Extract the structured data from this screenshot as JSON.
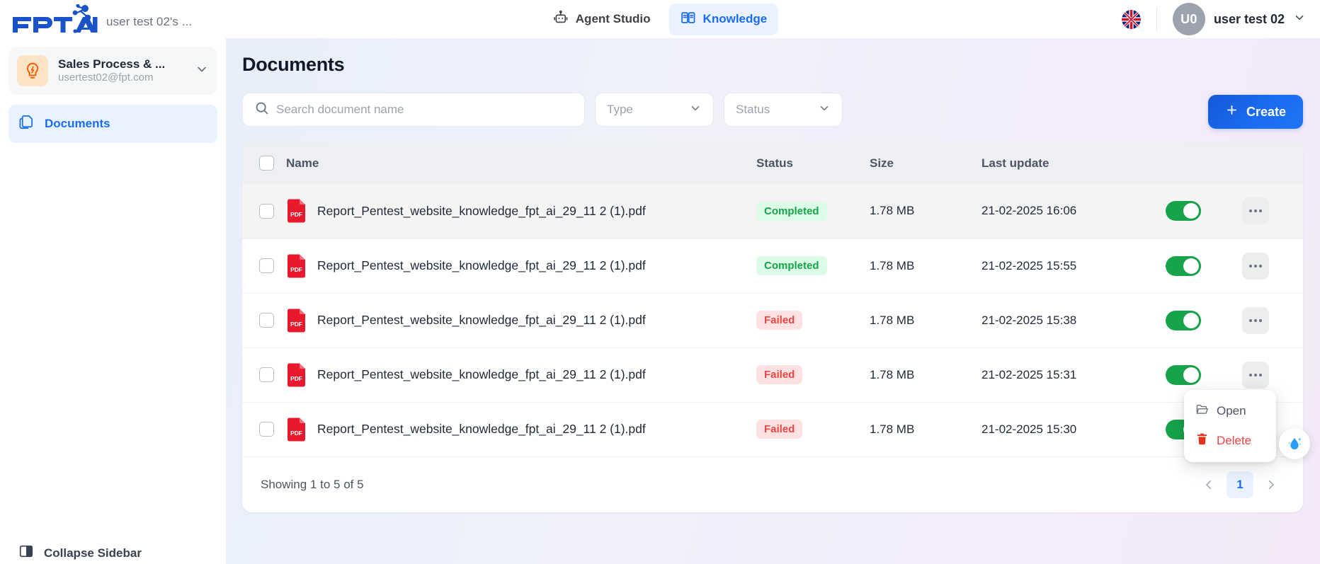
{
  "header": {
    "brand_sub": "user test 02's ...",
    "nav": [
      {
        "label": "Agent Studio",
        "icon": "robot-icon",
        "active": false
      },
      {
        "label": "Knowledge",
        "icon": "book-icon",
        "active": true
      }
    ],
    "flag": "uk-flag-icon",
    "avatar_initials": "U0",
    "user_name": "user test 02"
  },
  "sidebar": {
    "kb_title": "Sales Process & ...",
    "kb_email": "usertest02@fpt.com",
    "nav_documents": "Documents",
    "collapse_label": "Collapse Sidebar"
  },
  "main": {
    "page_title": "Documents",
    "search_placeholder": "Search document name",
    "search_value": "",
    "type_label": "Type",
    "status_label": "Status",
    "create_label": "Create"
  },
  "table": {
    "columns": [
      "Name",
      "Status",
      "Size",
      "Last update"
    ],
    "rows": [
      {
        "name": "Report_Pentest_website_knowledge_fpt_ai_29_11 2 (1).pdf",
        "status": "Completed",
        "size": "1.78 MB",
        "updated": "21-02-2025 16:06",
        "enabled": true,
        "filetype": "PDF"
      },
      {
        "name": "Report_Pentest_website_knowledge_fpt_ai_29_11 2 (1).pdf",
        "status": "Completed",
        "size": "1.78 MB",
        "updated": "21-02-2025 15:55",
        "enabled": true,
        "filetype": "PDF"
      },
      {
        "name": "Report_Pentest_website_knowledge_fpt_ai_29_11 2 (1).pdf",
        "status": "Failed",
        "size": "1.78 MB",
        "updated": "21-02-2025 15:38",
        "enabled": true,
        "filetype": "PDF"
      },
      {
        "name": "Report_Pentest_website_knowledge_fpt_ai_29_11 2 (1).pdf",
        "status": "Failed",
        "size": "1.78 MB",
        "updated": "21-02-2025 15:31",
        "enabled": true,
        "filetype": "PDF"
      },
      {
        "name": "Report_Pentest_website_knowledge_fpt_ai_29_11 2 (1).pdf",
        "status": "Failed",
        "size": "1.78 MB",
        "updated": "21-02-2025 15:30",
        "enabled": true,
        "filetype": "PDF"
      }
    ]
  },
  "footer": {
    "showing": "Showing 1 to 5 of 5",
    "page_current": "1"
  },
  "context_menu": {
    "open_label": "Open",
    "delete_label": "Delete"
  },
  "colors": {
    "accent_blue": "#1a6cf0",
    "success_green": "#16a34a",
    "danger_red": "#ef4444",
    "pdf_red": "#e8192c",
    "kb_orange": "#f97316"
  }
}
